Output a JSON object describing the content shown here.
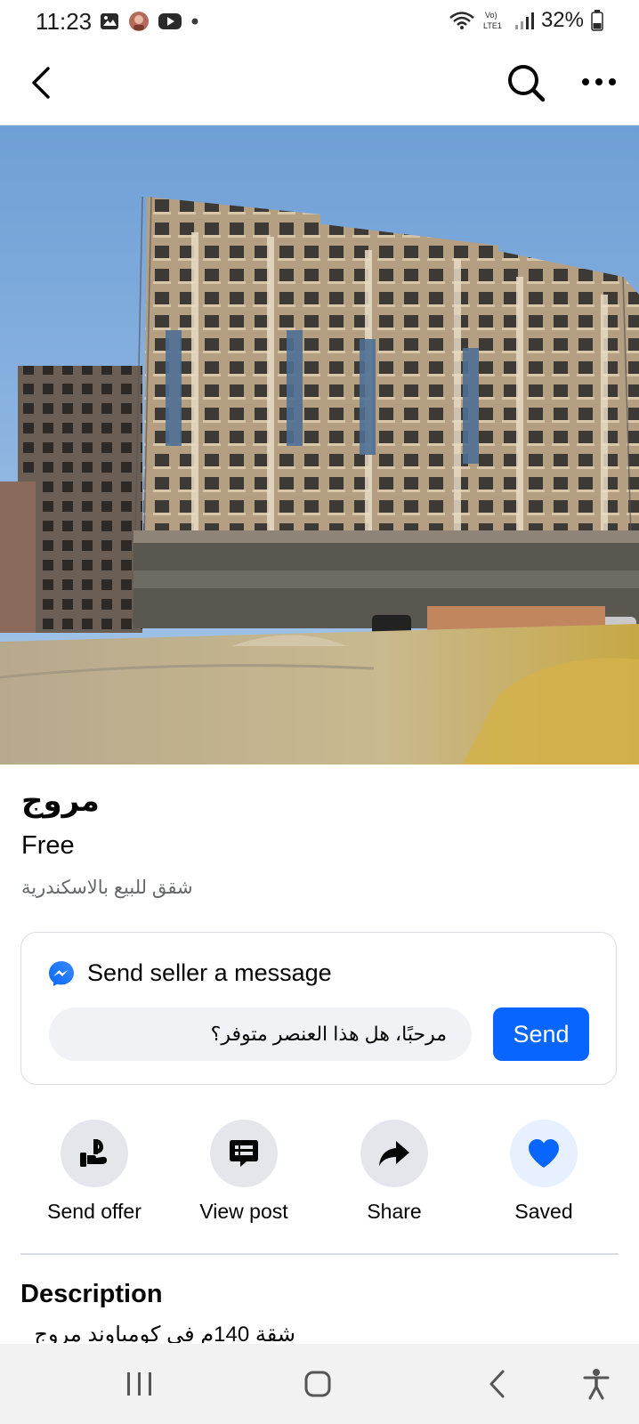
{
  "status_bar": {
    "time": "11:23",
    "battery": "32%",
    "network": "VoLTE1"
  },
  "app_bar": {
    "back_icon": "chevron-left-icon",
    "search_icon": "search-icon",
    "more_icon": "more-horizontal-icon"
  },
  "listing": {
    "title": "مروج",
    "price": "Free",
    "location": "شقق للبيع بالاسكندرية"
  },
  "message_card": {
    "header": "Send seller a message",
    "input_value": "مرحبًا، هل هذا العنصر متوفر؟",
    "send_label": "Send",
    "icon": "messenger-icon"
  },
  "actions": [
    {
      "label": "Send offer",
      "icon": "offer-hand-icon"
    },
    {
      "label": "View post",
      "icon": "post-icon"
    },
    {
      "label": "Share",
      "icon": "share-arrow-icon"
    },
    {
      "label": "Saved",
      "icon": "heart-icon"
    }
  ],
  "description": {
    "heading": "Description",
    "text": "شقة 140م في كومباوند مروج"
  },
  "colors": {
    "accent": "#0866ff",
    "secondary_text": "#65676b",
    "action_bg": "#e4e6eb",
    "saved_bg": "#e7f0fe"
  }
}
